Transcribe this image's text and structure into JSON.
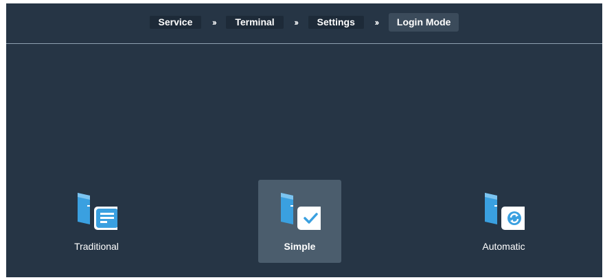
{
  "breadcrumb": {
    "items": [
      "Service",
      "Terminal",
      "Settings",
      "Login Mode"
    ],
    "separator": "››"
  },
  "modes": [
    {
      "label": "Traditional",
      "icon": "lines-icon",
      "selected": false
    },
    {
      "label": "Simple",
      "icon": "check-icon",
      "selected": true
    },
    {
      "label": "Automatic",
      "icon": "refresh-icon",
      "selected": false
    }
  ],
  "colors": {
    "background": "#263545",
    "accent": "#3aa0e0",
    "selected": "#4b5d6d"
  }
}
